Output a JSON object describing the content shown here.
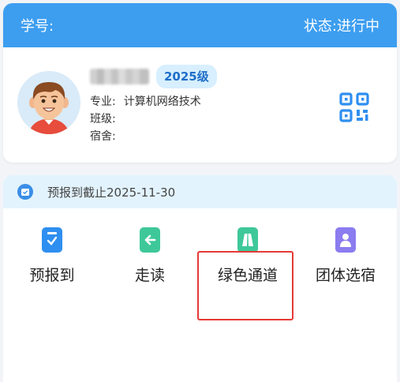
{
  "header": {
    "student_id_label": "学号:",
    "status_label": "状态:",
    "status_value": "进行中"
  },
  "profile": {
    "grade_badge": "2025级",
    "major_label": "专业:",
    "major_value": "计算机网络技术",
    "class_label": "班级:",
    "class_value": "",
    "dorm_label": "宿舍:",
    "dorm_value": ""
  },
  "deadline": {
    "text": "预报到截止2025-11-30"
  },
  "services": [
    {
      "label": "预报到",
      "icon": "checklist-icon",
      "color": "#2f8ff0"
    },
    {
      "label": "走读",
      "icon": "arrow-left-icon",
      "color": "#3ec89a"
    },
    {
      "label": "绿色通道",
      "icon": "road-icon",
      "color": "#3ec89a"
    },
    {
      "label": "团体选宿",
      "icon": "person-icon",
      "color": "#8b7cf0"
    }
  ],
  "colors": {
    "header_bg": "#3d9ef0",
    "badge_bg": "#d7efff",
    "badge_text": "#1f6fc8",
    "deadline_bg": "#e2f3fd",
    "highlight": "#e53935"
  }
}
